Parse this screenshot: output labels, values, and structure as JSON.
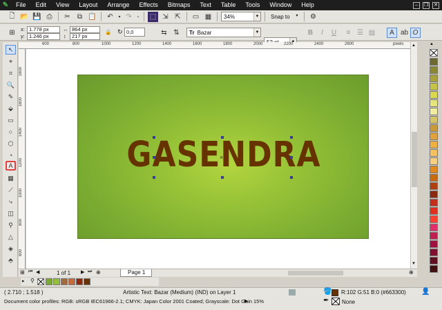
{
  "menu": {
    "items": [
      "File",
      "Edit",
      "View",
      "Layout",
      "Arrange",
      "Effects",
      "Bitmaps",
      "Text",
      "Table",
      "Tools",
      "Window",
      "Help"
    ]
  },
  "toolbar": {
    "zoom_value": "34%",
    "snap_label": "Snap to"
  },
  "property_bar": {
    "x_value": "1.778 px",
    "y_value": "1.246 px",
    "width_value": "864 px",
    "height_value": "217 px",
    "x_label": "x:",
    "y_label": "y:",
    "rotation_value": "0,0",
    "font_name": "Bazar",
    "font_size": "52 pt",
    "font_prefix": "Tr"
  },
  "ruler": {
    "unit": "pixels",
    "h_ticks": [
      "600",
      "800",
      "1000",
      "1200",
      "1400",
      "1600",
      "1800",
      "2000",
      "2200",
      "2400",
      "2600"
    ],
    "v_ticks": [
      "1800",
      "1600",
      "1400",
      "1200",
      "1000",
      "800",
      "600"
    ]
  },
  "canvas": {
    "headline": "GASENDRA",
    "headline_color": "#663300",
    "bg_gradient": [
      "#b3d53f",
      "#6a9a2c"
    ]
  },
  "page_nav": {
    "page_count": "1 of 1",
    "page_tab": "Page 1"
  },
  "status": {
    "coordinates": "( 2.710 ; 1.518 )",
    "object_info": "Artistic Text: Bazar (Medium) (IND) on Layer 1",
    "fill_info": "R:102 G:51 B:0 (#663300)",
    "outline_info": "None",
    "color_profiles": "Document color profiles: RGB: sRGB IEC61966-2.1; CMYK: Japan Color 2001 Coated; Grayscale: Dot Gain 15%"
  },
  "colors": {
    "fill": "#663300",
    "accent": "#2e7d32"
  },
  "palette_colors": [
    "#6d6a30",
    "#8a8735",
    "#a8a23c",
    "#c6c24a",
    "#dad84f",
    "#e6e47c",
    "#f0ee9e",
    "#d6c46b",
    "#c89a3c",
    "#e0a23a",
    "#f0b040",
    "#f5c060",
    "#f5d080",
    "#e08a1e",
    "#c86a10",
    "#b04010",
    "#8a2a10",
    "#c0301a",
    "#e03020",
    "#ff4030",
    "#e0306a",
    "#c02050",
    "#a01040",
    "#801030",
    "#601020",
    "#401010"
  ],
  "doc_palette": [
    "#7aab31",
    "#93c036",
    "#a36a3b",
    "#c46a3b",
    "#8a2a10",
    "#663300"
  ]
}
